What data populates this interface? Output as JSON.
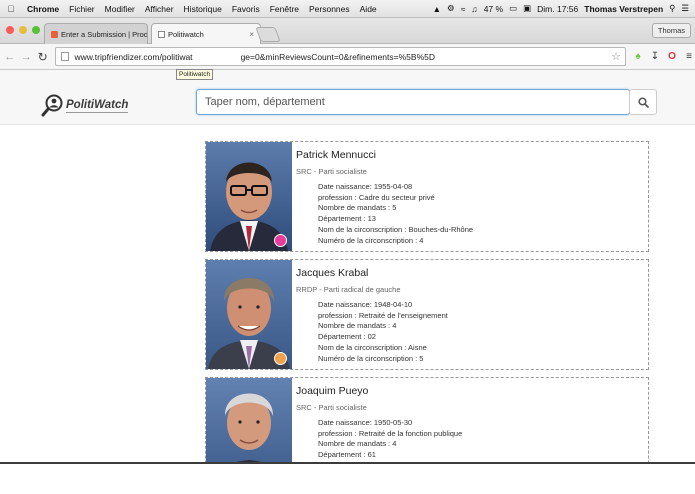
{
  "menubar": {
    "app": "Chrome",
    "items": [
      "Fichier",
      "Modifier",
      "Afficher",
      "Historique",
      "Favoris",
      "Fenêtre",
      "Personnes",
      "Aide"
    ],
    "battery": "47 %",
    "clock": "Dim. 17:56",
    "user": "Thomas Verstrepen"
  },
  "tabs": [
    {
      "label": "Enter a Submission | Produ",
      "close": "×"
    },
    {
      "label": "Politiwatch",
      "close": "×"
    }
  ],
  "profile_button": "Thomas",
  "toolbar": {
    "url": "www.tripfriendizer.com/politiwat",
    "url_tail": "ge=0&minReviewsCount=0&refinements=%5B%5D",
    "tooltip": "Politiwatch"
  },
  "header": {
    "logo_text": "PolitiWatch",
    "search_placeholder": "Taper nom, département"
  },
  "colors": {
    "socialist_dot": "#e93b9b",
    "radical_dot": "#f1a24a",
    "search_border": "#6fa7d6"
  },
  "deputies": [
    {
      "name": "Patrick Mennucci",
      "party": "SRC - Parti socialiste",
      "birth": "Date naissance: 1955-04-08",
      "profession": "profession : Cadre du secteur privé",
      "mandates": "Nombre de mandats : 5",
      "department": "Département : 13",
      "circ_name": "Nom de la circonscription : Bouches-du-Rhône",
      "circ_number": "Numéro de la circonscription : 4"
    },
    {
      "name": "Jacques Krabal",
      "party": "RRDP - Parti radical de gauche",
      "birth": "Date naissance: 1948-04-10",
      "profession": "profession : Retraité de l'enseignement",
      "mandates": "Nombre de mandats : 4",
      "department": "Département : 02",
      "circ_name": "Nom de la circonscription : Aisne",
      "circ_number": "Numéro de la circonscription : 5"
    },
    {
      "name": "Joaquim Pueyo",
      "party": "SRC - Parti socialiste",
      "birth": "Date naissance: 1950-05-30",
      "profession": "profession : Retraité de la fonction publique",
      "mandates": "Nombre de mandats : 4",
      "department": "Département : 61"
    }
  ]
}
